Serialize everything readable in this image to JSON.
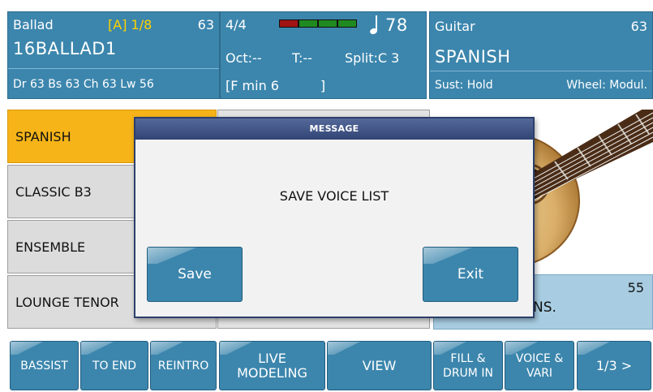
{
  "header": {
    "left": {
      "style_name": "Ballad",
      "variation": "[A] 1/8",
      "style_value": "63",
      "file_name": "16BALLAD1",
      "volumes": "Dr 63  Bs 63  Ch 63  Lw 56"
    },
    "mid": {
      "time_signature": "4/4",
      "tempo": "78",
      "octave": "Oct:--",
      "transpose": "T:--",
      "split": "Split:C 3",
      "chord": "[F min 6          ]",
      "meter_colors": [
        "#a01414",
        "#1f8a1f",
        "#1f8a1f",
        "#1f8a1f"
      ]
    },
    "right": {
      "category": "Guitar",
      "value": "63",
      "voice_name": "SPANISH",
      "sustain": "Sust: Hold",
      "wheel": "Wheel: Modul."
    }
  },
  "voice_list": {
    "items": [
      "SPANISH",
      "CLASSIC B3",
      "ENSEMBLE",
      "LOUNGE TENOR"
    ],
    "right_value": "55",
    "right_label": "NS."
  },
  "dialog": {
    "title": "MESSAGE",
    "message": "SAVE VOICE LIST",
    "save_label": "Save",
    "exit_label": "Exit"
  },
  "bottom_bar": {
    "bassist": "BASSIST",
    "to_end": "TO END",
    "reintro": "REINTRO",
    "live_modeling": "LIVE\nMODELING",
    "view": "VIEW",
    "fill_drum_in": "FILL &\nDRUM IN",
    "voice_vari": "VOICE &\nVARI",
    "page": "1/3 >"
  },
  "colors": {
    "panel_blue": "#3c86ad",
    "selected_orange": "#f6b419",
    "variation_yellow": "#ffd200",
    "dialog_title": "#314575"
  }
}
